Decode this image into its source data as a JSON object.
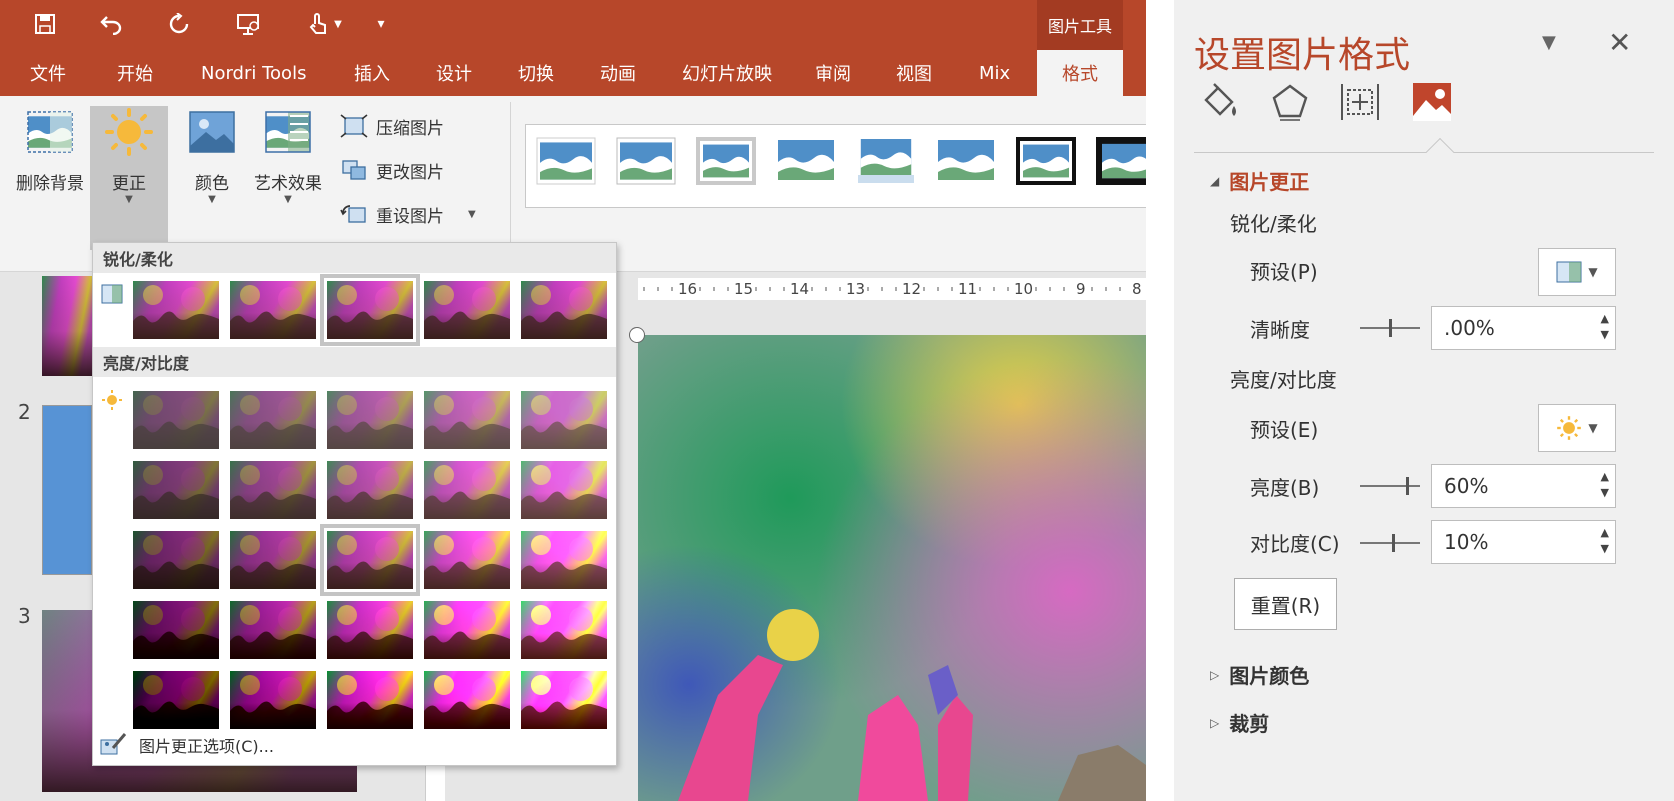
{
  "quick_access": {
    "icons": [
      "save-icon",
      "undo-icon",
      "redo-icon",
      "slideshow-icon",
      "touch-mode-icon",
      "customize-qat-icon"
    ]
  },
  "context_tool": "图片工具",
  "tabs": [
    "文件",
    "开始",
    "Nordri Tools",
    "插入",
    "设计",
    "切换",
    "动画",
    "幻灯片放映",
    "审阅",
    "视图",
    "Mix",
    "格式"
  ],
  "active_tab": "格式",
  "ribbon": {
    "remove_bg": "删除背景",
    "corrections": "更正",
    "color": "颜色",
    "artistic": "艺术效果",
    "compress": "压缩图片",
    "change": "更改图片",
    "reset": "重设图片"
  },
  "ruler": [
    "16",
    "15",
    "14",
    "13",
    "12",
    "11",
    "10",
    "9",
    "8"
  ],
  "slide_numbers": [
    "2",
    "3"
  ],
  "dropdown": {
    "sharpen_header": "锐化/柔化",
    "brightness_header": "亮度/对比度",
    "options_link": "图片更正选项(C)..."
  },
  "format_pane": {
    "title": "设置图片格式",
    "sections": {
      "corrections": "图片更正",
      "color": "图片颜色",
      "crop": "裁剪"
    },
    "sharpen_group": "锐化/柔化",
    "preset_p": "预设(P)",
    "clarity_label": "清晰度",
    "clarity_value": ".00%",
    "bc_group": "亮度/对比度",
    "preset_e": "预设(E)",
    "brightness_label": "亮度(B)",
    "brightness_value": "60%",
    "contrast_label": "对比度(C)",
    "contrast_value": "10%",
    "reset_button": "重置(R)"
  },
  "colors": {
    "accent": "#b7472a",
    "ribbon_bg": "#f3f3f3",
    "pane_bg": "#f0f0f0"
  }
}
